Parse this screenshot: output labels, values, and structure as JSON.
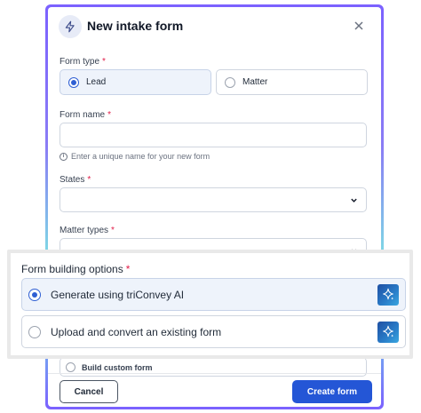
{
  "modal": {
    "title": "New intake form",
    "icon": "lightning-icon",
    "close_icon": "close-icon"
  },
  "form_type": {
    "label": "Form type",
    "required_mark": "*",
    "options": [
      {
        "label": "Lead",
        "selected": true
      },
      {
        "label": "Matter",
        "selected": false
      }
    ]
  },
  "form_name": {
    "label": "Form name",
    "required_mark": "*",
    "value": "",
    "placeholder": "",
    "hint": "Enter a unique name for your new form",
    "hint_icon": "info-icon"
  },
  "states": {
    "label": "States",
    "required_mark": "*",
    "value": ""
  },
  "matter_types": {
    "label": "Matter types",
    "required_mark": "*",
    "value": ""
  },
  "form_building": {
    "label": "Form building options",
    "required_mark": "*",
    "options": [
      {
        "label": "Generate using triConvey AI",
        "selected": true,
        "icon": "sparkle-icon"
      },
      {
        "label": "Upload and convert an existing form",
        "selected": false,
        "icon": "sparkle-icon"
      }
    ],
    "partial_option": "Build custom form"
  },
  "footer": {
    "cancel_label": "Cancel",
    "create_label": "Create form"
  },
  "colors": {
    "primary": "#2456d6",
    "required": "#e11d48",
    "frame_start": "#7b61ff",
    "frame_mid": "#6fd7e8"
  }
}
